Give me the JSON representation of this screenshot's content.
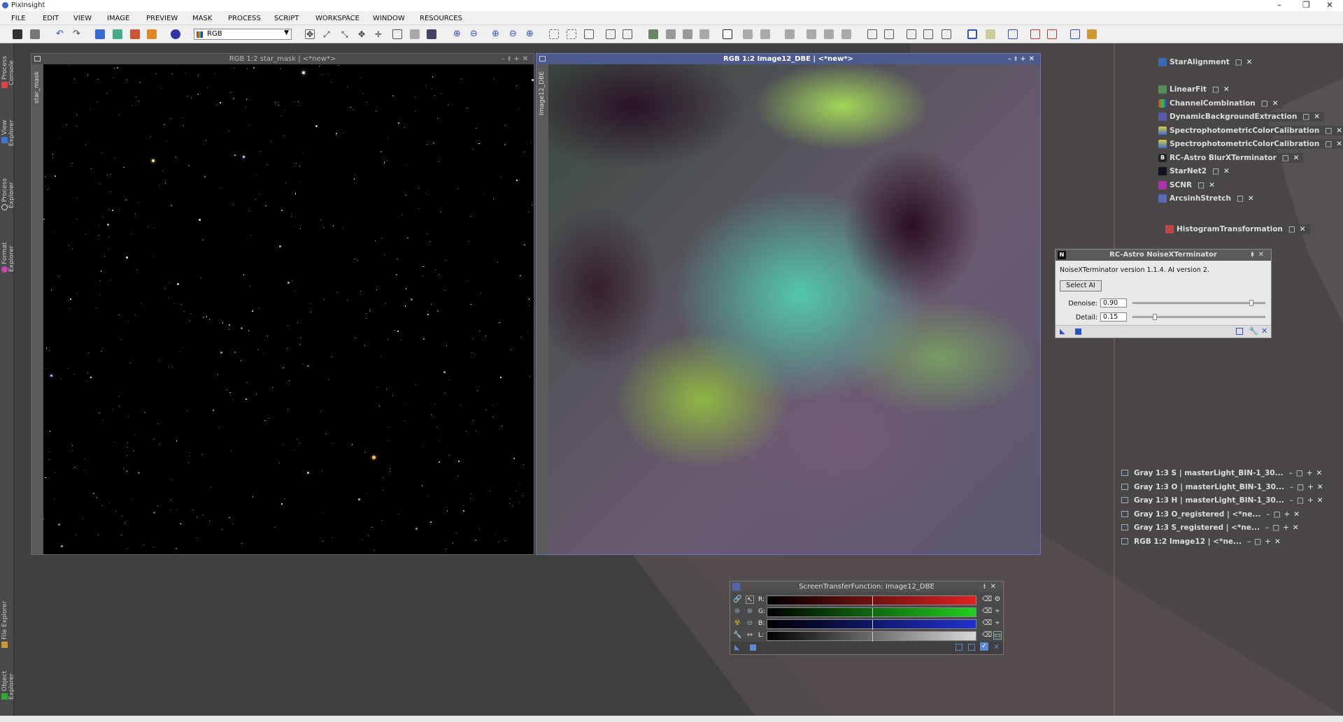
{
  "app": {
    "title": "PixInsight"
  },
  "menu": [
    "FILE",
    "EDIT",
    "VIEW",
    "IMAGE",
    "PREVIEW",
    "MASK",
    "PROCESS",
    "SCRIPT",
    "WORKSPACE",
    "WINDOW",
    "RESOURCES"
  ],
  "toolbar": {
    "combo_value": "RGB"
  },
  "sidebar": {
    "top_tabs": [
      "Process Console",
      "View Explorer",
      "Process Explorer",
      "Format Explorer"
    ],
    "bottom_tabs": [
      "File Explorer",
      "Object Explorer"
    ]
  },
  "windows": {
    "left": {
      "title": "RGB 1:2 star_mask | <*new*>",
      "side_label": "star_mask"
    },
    "right": {
      "title": "RGB 1:2 Image12_DBE | <*new*>",
      "side_label": "Image12_DBE"
    }
  },
  "process_icons": [
    "StarAlignment",
    "LinearFit",
    "ChannelCombination",
    "DynamicBackgroundExtraction",
    "SpectrophotometricColorCalibration",
    "SpectrophotometricColorCalibration",
    "RC-Astro BlurXTerminator",
    "StarNet2",
    "SCNR",
    "ArcsinhStretch",
    "HistogramTransformation"
  ],
  "image_icons": [
    "Gray 1:3 S | masterLight_BIN-1_30...",
    "Gray 1:3 O | masterLight_BIN-1_30...",
    "Gray 1:3 H | masterLight_BIN-1_30...",
    "Gray 1:3 O_registered | <*ne...",
    "Gray 1:3 S_registered | <*ne...",
    "RGB 1:2 Image12 | <*ne..."
  ],
  "nxt": {
    "title": "RC-Astro NoiseXTerminator",
    "version_text": "NoiseXTerminator version 1.1.4. AI version 2.",
    "select_ai": "Select AI",
    "denoise_label": "Denoise:",
    "denoise_value": "0.90",
    "denoise_level": 0.9,
    "detail_label": "Detail:",
    "detail_value": "0.15",
    "detail_level": 0.15
  },
  "stf": {
    "title": "ScreenTransferFunction: Image12_DBE",
    "channels": [
      "R:",
      "G:",
      "B:",
      "L:"
    ],
    "colors": {
      "R": "#e02020",
      "G": "#20d020",
      "B": "#2030d0",
      "L": "#d8d8d8"
    }
  }
}
